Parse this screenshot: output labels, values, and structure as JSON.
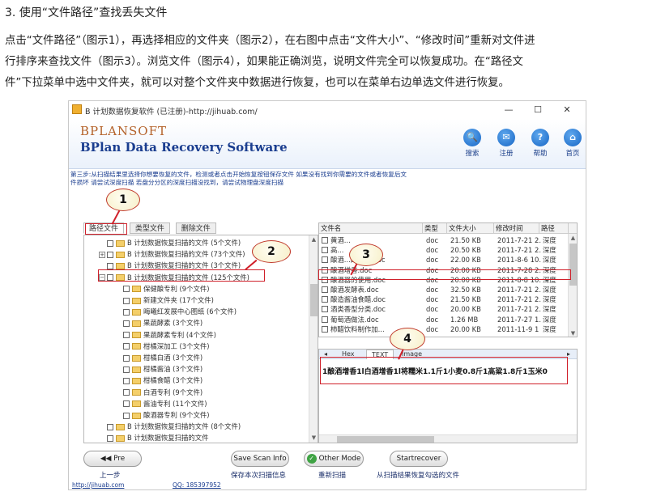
{
  "heading": "3. 使用“文件路径”查找丢失文件",
  "paragraph": {
    "line1": "点击“文件路径”（图示1），再选择相应的文件夹（图示2），在右图中点击“文件大小”、“修改时间”重新对文件进",
    "line2": "行排序来查找文件（图示3）。浏览文件（图示4），如果能正确浏览，说明文件完全可以恢复成功。在“路径文",
    "line3": "件”下拉菜单中选中文件夹，就可以对整个文件夹中数据进行恢复，也可以在菜单右边单选文件进行恢复。"
  },
  "window": {
    "title": "B 计划数据恢复软件 (已注册)-http://jihuab.com/",
    "minimize": "—",
    "maximize": "☐",
    "close": "✕"
  },
  "banner": {
    "logo_top": "BPLANSOFT",
    "logo_bottom": "BPlan Data Recovery Software",
    "buttons": [
      {
        "label": "搜索",
        "glyph": "🔍",
        "icon": "search-icon"
      },
      {
        "label": "注册",
        "glyph": "✉",
        "icon": "register-icon"
      },
      {
        "label": "帮助",
        "glyph": "?",
        "icon": "help-icon"
      },
      {
        "label": "首页",
        "glyph": "⌂",
        "icon": "home-icon"
      }
    ]
  },
  "instructions": {
    "line1": "第三步:从扫描结果里选择你想要恢复的文件，检测或者点击开始恢复按钮保存文件 如果没有找到你需要的文件或者恢复后文",
    "line2": "件损坏 请尝试深度扫描 若盘分分区的深度扫描没找到，请尝试物理盘深度扫描"
  },
  "tabs": [
    "路径文件",
    "类型文件",
    "删除文件"
  ],
  "tree": [
    {
      "label": "B 计划数据恢复扫描的文件 (5个文件)",
      "level": 0,
      "expander": ""
    },
    {
      "label": "B 计划数据恢复扫描的文件 (73个文件)",
      "level": 0,
      "expander": "+"
    },
    {
      "label": "B 计划数据恢复扫描的文件 (3个文件)",
      "level": 0,
      "expander": ""
    },
    {
      "label": "B 计划数据恢复扫描的文件 (125个文件)",
      "level": 0,
      "expander": "−"
    },
    {
      "label": "保健酿专利 (9个文件)",
      "level": 1,
      "expander": ""
    },
    {
      "label": "新建文件夹 (17个文件)",
      "level": 1,
      "expander": ""
    },
    {
      "label": "晦曦红发展中心图纸 (6个文件)",
      "level": 1,
      "expander": ""
    },
    {
      "label": "果蔬酵素 (3个文件)",
      "level": 1,
      "expander": ""
    },
    {
      "label": "果蔬酵素专利 (4个文件)",
      "level": 1,
      "expander": ""
    },
    {
      "label": "柑橘深加工 (3个文件)",
      "level": 1,
      "expander": ""
    },
    {
      "label": "柑橘白酒 (3个文件)",
      "level": 1,
      "expander": ""
    },
    {
      "label": "柑橘酱油 (3个文件)",
      "level": 1,
      "expander": ""
    },
    {
      "label": "柑橘食醋 (3个文件)",
      "level": 1,
      "expander": ""
    },
    {
      "label": "白酒专利 (9个文件)",
      "level": 1,
      "expander": ""
    },
    {
      "label": "酱油专利 (11个文件)",
      "level": 1,
      "expander": ""
    },
    {
      "label": "酿酒器专利 (9个文件)",
      "level": 1,
      "expander": ""
    },
    {
      "label": "B 计划数据恢复扫描的文件 (8个文件)",
      "level": 0,
      "expander": ""
    },
    {
      "label": "B 计划数据恢复扫描的文件",
      "level": 0,
      "expander": ""
    }
  ],
  "filelist": {
    "headers": [
      "文件名",
      "类型",
      "文件大小",
      "修改时间",
      "路径"
    ],
    "rows": [
      [
        "黄酒...",
        "doc",
        "21.50 KB",
        "2011-7-21 2...",
        "深度"
      ],
      [
        "高...",
        "doc",
        "20.50 KB",
        "2011-7-21 2...",
        "深度"
      ],
      [
        "酿酒...的问题.doc",
        "doc",
        "22.00 KB",
        "2011-8-6 10...",
        "深度"
      ],
      [
        "酿酒增香.doc",
        "doc",
        "20.00 KB",
        "2011-7-28 2...",
        "深度"
      ],
      [
        "酿酒器的使用.doc",
        "doc",
        "20.00 KB",
        "2011-8-8 10...",
        "深度"
      ],
      [
        "酿酒发酵表.doc",
        "doc",
        "32.50 KB",
        "2011-7-21 2...",
        "深度"
      ],
      [
        "酿造酱油食醋.doc",
        "doc",
        "21.50 KB",
        "2011-7-21 2...",
        "深度"
      ],
      [
        "酒类香型分类.doc",
        "doc",
        "20.00 KB",
        "2011-7-21 2...",
        "深度"
      ],
      [
        "葡萄酒做法.doc",
        "doc",
        "1.26 MB",
        "2011-7-27 1...",
        "深度"
      ],
      [
        "柿醋饮料制作加...",
        "doc",
        "20.00 KB",
        "2011-11-9 1",
        "深度"
      ]
    ]
  },
  "preview": {
    "tabs": [
      "Hex",
      "TEXT",
      "Image"
    ],
    "content": "1酿酒增香1l白酒增香1l将糯米1.1斤1小麦0.8斤1高粱1.8斤1玉米0"
  },
  "buttons": {
    "prev": "Pre",
    "prev_caption": "上一步",
    "save": "Save Scan Info",
    "save_caption": "保存本次扫描信息",
    "mode": "Other Mode",
    "mode_caption": "重新扫描",
    "recover": "Startrecover",
    "recover_caption": "从扫描结果恢复勾选的文件"
  },
  "footer": {
    "link": "http://jihuab.com",
    "qq": "QQ: 185397952"
  },
  "callouts": [
    "1",
    "2",
    "3",
    "4"
  ],
  "colors": {
    "annotation_red": "#d0202a",
    "brand_blue": "#1a3d8f",
    "brand_orange": "#b4622a"
  }
}
